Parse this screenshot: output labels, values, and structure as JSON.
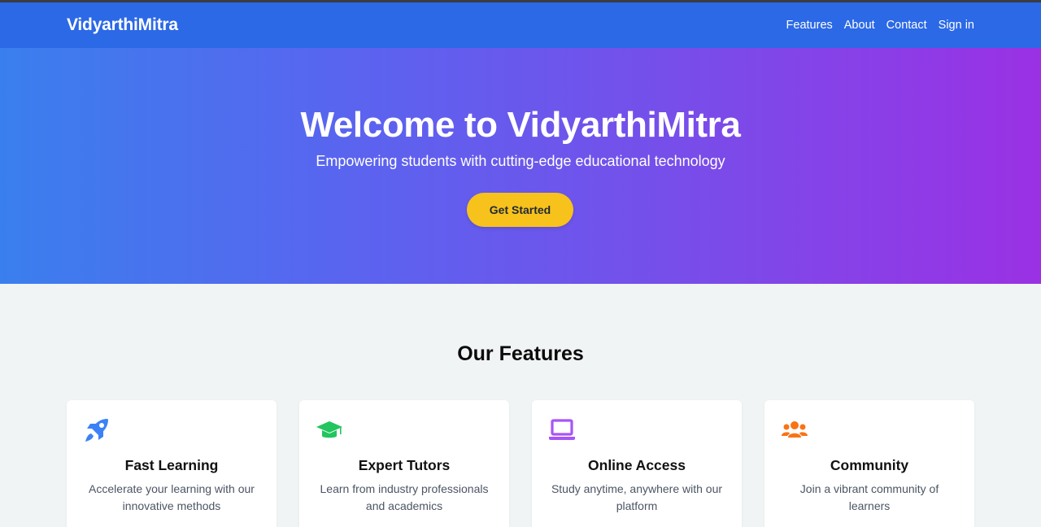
{
  "nav": {
    "brand": "VidyarthiMitra",
    "links": [
      "Features",
      "About",
      "Contact",
      "Sign in"
    ]
  },
  "hero": {
    "title": "Welcome to VidyarthiMitra",
    "subtitle": "Empowering students with cutting-edge educational technology",
    "cta_label": "Get Started"
  },
  "features": {
    "heading": "Our Features",
    "cards": [
      {
        "icon": "rocket-icon",
        "color": "#3b82f6",
        "title": "Fast Learning",
        "description": "Accelerate your learning with our innovative methods"
      },
      {
        "icon": "graduation-cap-icon",
        "color": "#22c55e",
        "title": "Expert Tutors",
        "description": "Learn from industry professionals and academics"
      },
      {
        "icon": "laptop-icon",
        "color": "#a855f7",
        "title": "Online Access",
        "description": "Study anytime, anywhere with our platform"
      },
      {
        "icon": "users-icon",
        "color": "#f97316",
        "title": "Community",
        "description": "Join a vibrant community of learners"
      }
    ]
  },
  "colors": {
    "navbar": "#2b69e6",
    "hero_gradient_start": "#3a7fee",
    "hero_gradient_end": "#9a31e4",
    "cta": "#f7c21b",
    "page_background": "#f1f4f5"
  }
}
